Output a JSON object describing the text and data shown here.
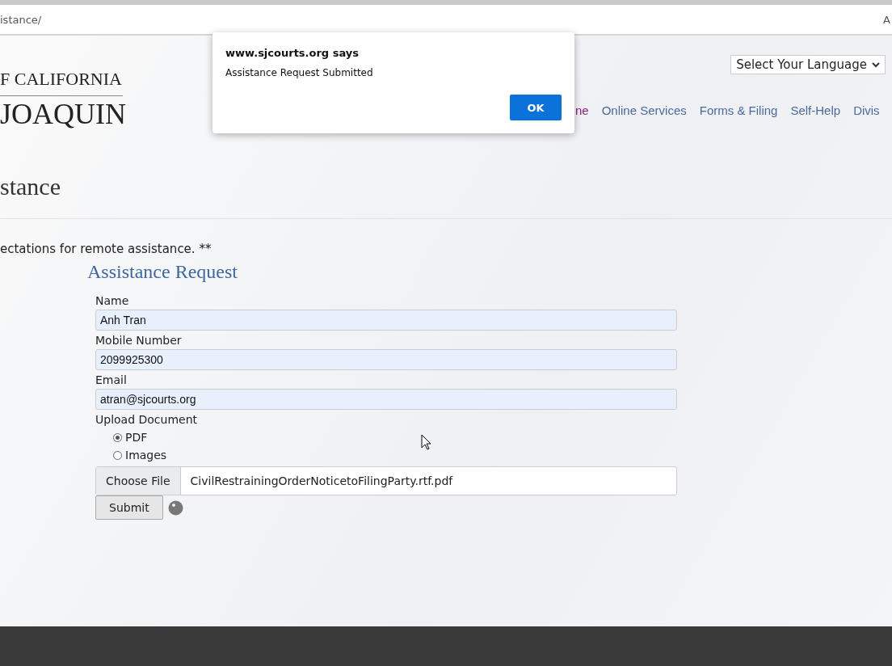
{
  "address_bar": {
    "url": "istance/",
    "right_text": "A"
  },
  "logo": {
    "line_1": "F CALIFORNIA",
    "line_2": "JOAQUIN"
  },
  "language_select": {
    "value": "Select Your Language"
  },
  "nav": [
    {
      "label": "ne",
      "visited": true
    },
    {
      "label": "Online Services",
      "visited": false
    },
    {
      "label": "Forms & Filing",
      "visited": false
    },
    {
      "label": "Self-Help",
      "visited": false
    },
    {
      "label": "Divis",
      "visited": false
    }
  ],
  "page_title": "stance",
  "intro": "ectations for remote assistance. **",
  "form": {
    "title": "Assistance Request",
    "fields": [
      {
        "label": "Name",
        "value": "Anh Tran"
      },
      {
        "label": "Mobile Number",
        "value": "2099925300"
      },
      {
        "label": "Email",
        "value": "atran@sjcourts.org"
      }
    ],
    "upload_label": "Upload Document",
    "options": [
      {
        "label": "PDF",
        "selected": true
      },
      {
        "label": "Images",
        "selected": false
      }
    ],
    "file_button": "Choose File",
    "file_name": "CivilRestrainingOrderNoticetoFilingParty.rtf.pdf",
    "submit": "Submit"
  },
  "dialog": {
    "title": "www.sjcourts.org says",
    "message": "Assistance Request Submitted",
    "button": "OK"
  }
}
